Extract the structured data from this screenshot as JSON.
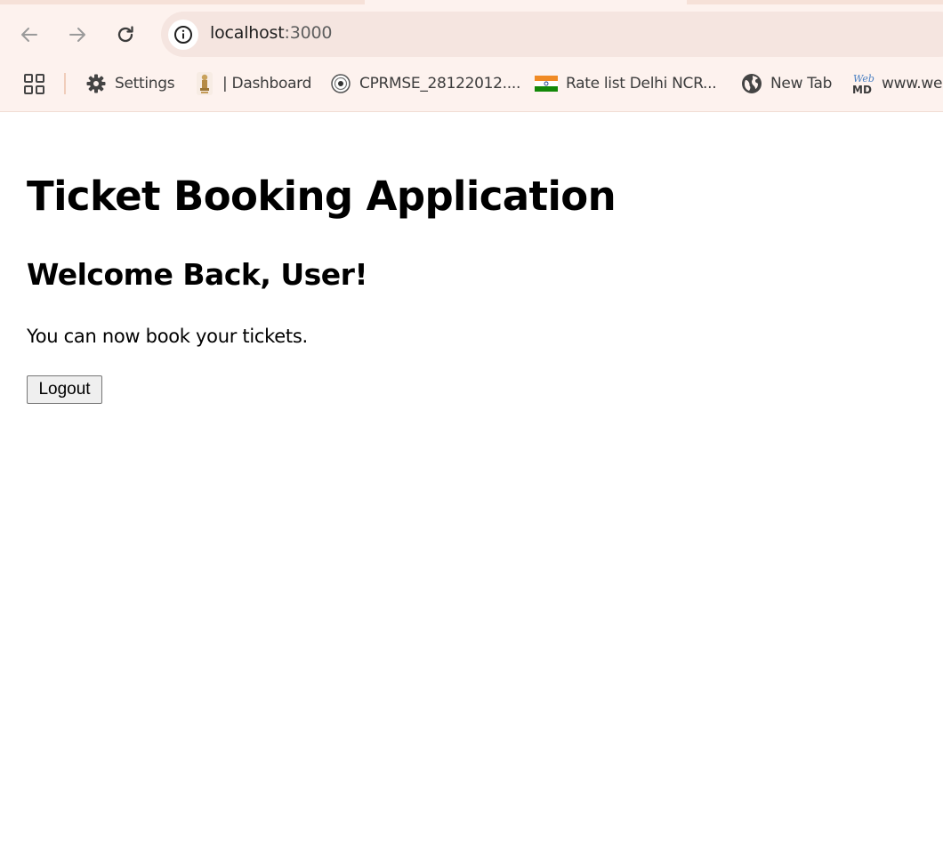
{
  "browser": {
    "url_host": "localhost",
    "url_port": ":3000",
    "bookmarks": [
      {
        "label": "Settings",
        "icon": "gear-icon"
      },
      {
        "label": "| Dashboard",
        "icon": "emblem-icon"
      },
      {
        "label": "CPRMSE_28122012....",
        "icon": "seal-icon"
      },
      {
        "label": "Rate list Delhi NCR...",
        "icon": "india-flag-icon"
      },
      {
        "label": "New Tab",
        "icon": "globe-icon"
      },
      {
        "label": "www.web",
        "icon": "webmd-icon"
      }
    ],
    "webmd_icon_text": [
      "Web",
      "MD"
    ]
  },
  "page": {
    "title": "Ticket Booking Application",
    "welcome": "Welcome Back, User!",
    "message": "You can now book your tickets.",
    "logout_label": "Logout"
  },
  "colors": {
    "chrome_bg": "#fdf2ee",
    "omnibox_bg": "#f5e5e0",
    "button_bg": "#efefef"
  }
}
